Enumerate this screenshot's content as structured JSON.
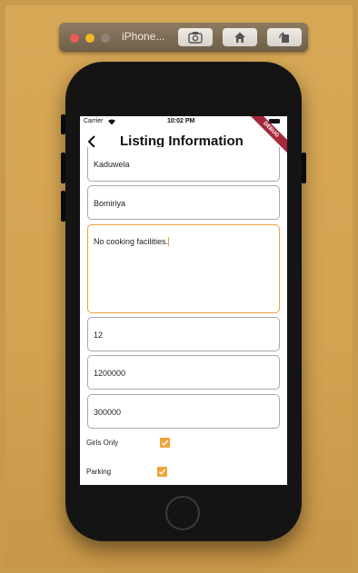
{
  "simulator": {
    "title": "iPhone...",
    "buttons": {
      "screenshot": "camera-icon",
      "home": "home-icon",
      "rotate": "rotate-icon"
    }
  },
  "status_bar": {
    "carrier": "Carrier",
    "time": "10:02 PM"
  },
  "debug_banner": "DEBUG",
  "app_bar": {
    "title": "Listing Information"
  },
  "form": {
    "city": "Kaduwela",
    "town": "Bomiriya",
    "description": "No cooking facilities.",
    "rooms": "12",
    "price": "1200000",
    "deposit": "300000",
    "girls_only": {
      "label": "Girls Only",
      "checked": true
    },
    "parking": {
      "label": "Parking",
      "checked": true
    }
  },
  "colors": {
    "accent": "#f0a43a",
    "focus_border": "#e8a33c",
    "backdrop": "#d3a352"
  }
}
